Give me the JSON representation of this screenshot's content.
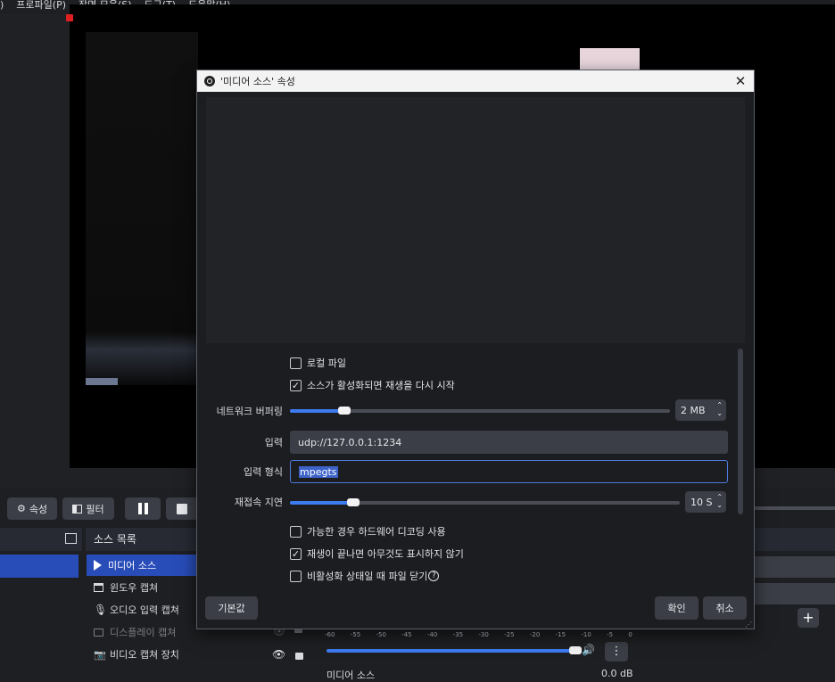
{
  "menubar": {
    "items": [
      ")",
      "프로파일(P)",
      "장면 모음(S)",
      "도구(T)",
      "도움말(H)"
    ]
  },
  "toolbar": {
    "properties_label": "속성",
    "filters_label": "필터"
  },
  "sources_panel": {
    "title": "소스 목록",
    "items": [
      {
        "label": "미디어 소스",
        "icon": "play-icon",
        "selected": true
      },
      {
        "label": "윈도우 캡쳐",
        "icon": "window-icon",
        "selected": false
      },
      {
        "label": "오디오 입력 캡쳐",
        "icon": "mic-icon",
        "selected": false
      },
      {
        "label": "디스플레이 캡쳐",
        "icon": "monitor-icon",
        "selected": false
      },
      {
        "label": "비디오 캡쳐 장치",
        "icon": "camera-icon",
        "selected": false
      }
    ]
  },
  "mixer": {
    "scale": [
      "-60",
      "-55",
      "-50",
      "-45",
      "-40",
      "-35",
      "-30",
      "-25",
      "-20",
      "-15",
      "-10",
      "-5",
      "0"
    ],
    "channel_name": "미디어 소스",
    "level": "0.0 dB"
  },
  "dialog": {
    "title": "'미디어 소스' 속성",
    "local_file_label": "로컬 파일",
    "local_file_checked": false,
    "restart_label": "소스가 활성화되면 재생을 다시 시작",
    "restart_checked": true,
    "network_buffering_label": "네트워크 버퍼링",
    "network_buffering_value": "2 MB",
    "network_buffering_fraction": 0.14,
    "input_label": "입력",
    "input_value": "udp://127.0.0.1:1234",
    "input_format_label": "입력 형식",
    "input_format_value": "mpegts",
    "reconnect_label": "재접속 지연",
    "reconnect_value": "10 S",
    "reconnect_fraction": 0.16,
    "hw_decode_label": "가능한 경우 하드웨어 디코딩 사용",
    "hw_decode_checked": false,
    "show_nothing_label": "재생이 끝나면 아무것도 표시하지 않기",
    "show_nothing_checked": true,
    "close_file_label": "비활성화 상태일 때 파일 닫기",
    "close_file_checked": false,
    "defaults_button": "기본값",
    "ok_button": "확인",
    "cancel_button": "취소"
  },
  "colors": {
    "accent": "#3d7bf0",
    "selection": "#284cb8",
    "panel_bg": "#1e1f22"
  }
}
